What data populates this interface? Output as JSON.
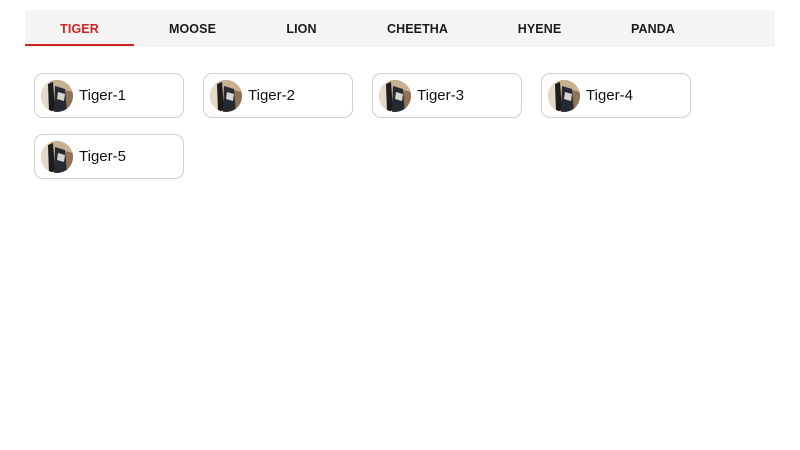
{
  "tabs": [
    {
      "label": "TIGER",
      "active": true
    },
    {
      "label": "MOOSE",
      "active": false
    },
    {
      "label": "LION",
      "active": false
    },
    {
      "label": "CHEETHA",
      "active": false
    },
    {
      "label": "HYENE",
      "active": false
    },
    {
      "label": "PANDA",
      "active": false
    }
  ],
  "accent_color": "#d32222",
  "cards": [
    {
      "label": "Tiger-1",
      "avatar": "person-photo-avatar"
    },
    {
      "label": "Tiger-2",
      "avatar": "person-photo-avatar"
    },
    {
      "label": "Tiger-3",
      "avatar": "person-photo-avatar"
    },
    {
      "label": "Tiger-4",
      "avatar": "person-photo-avatar"
    },
    {
      "label": "Tiger-5",
      "avatar": "person-photo-avatar"
    }
  ]
}
